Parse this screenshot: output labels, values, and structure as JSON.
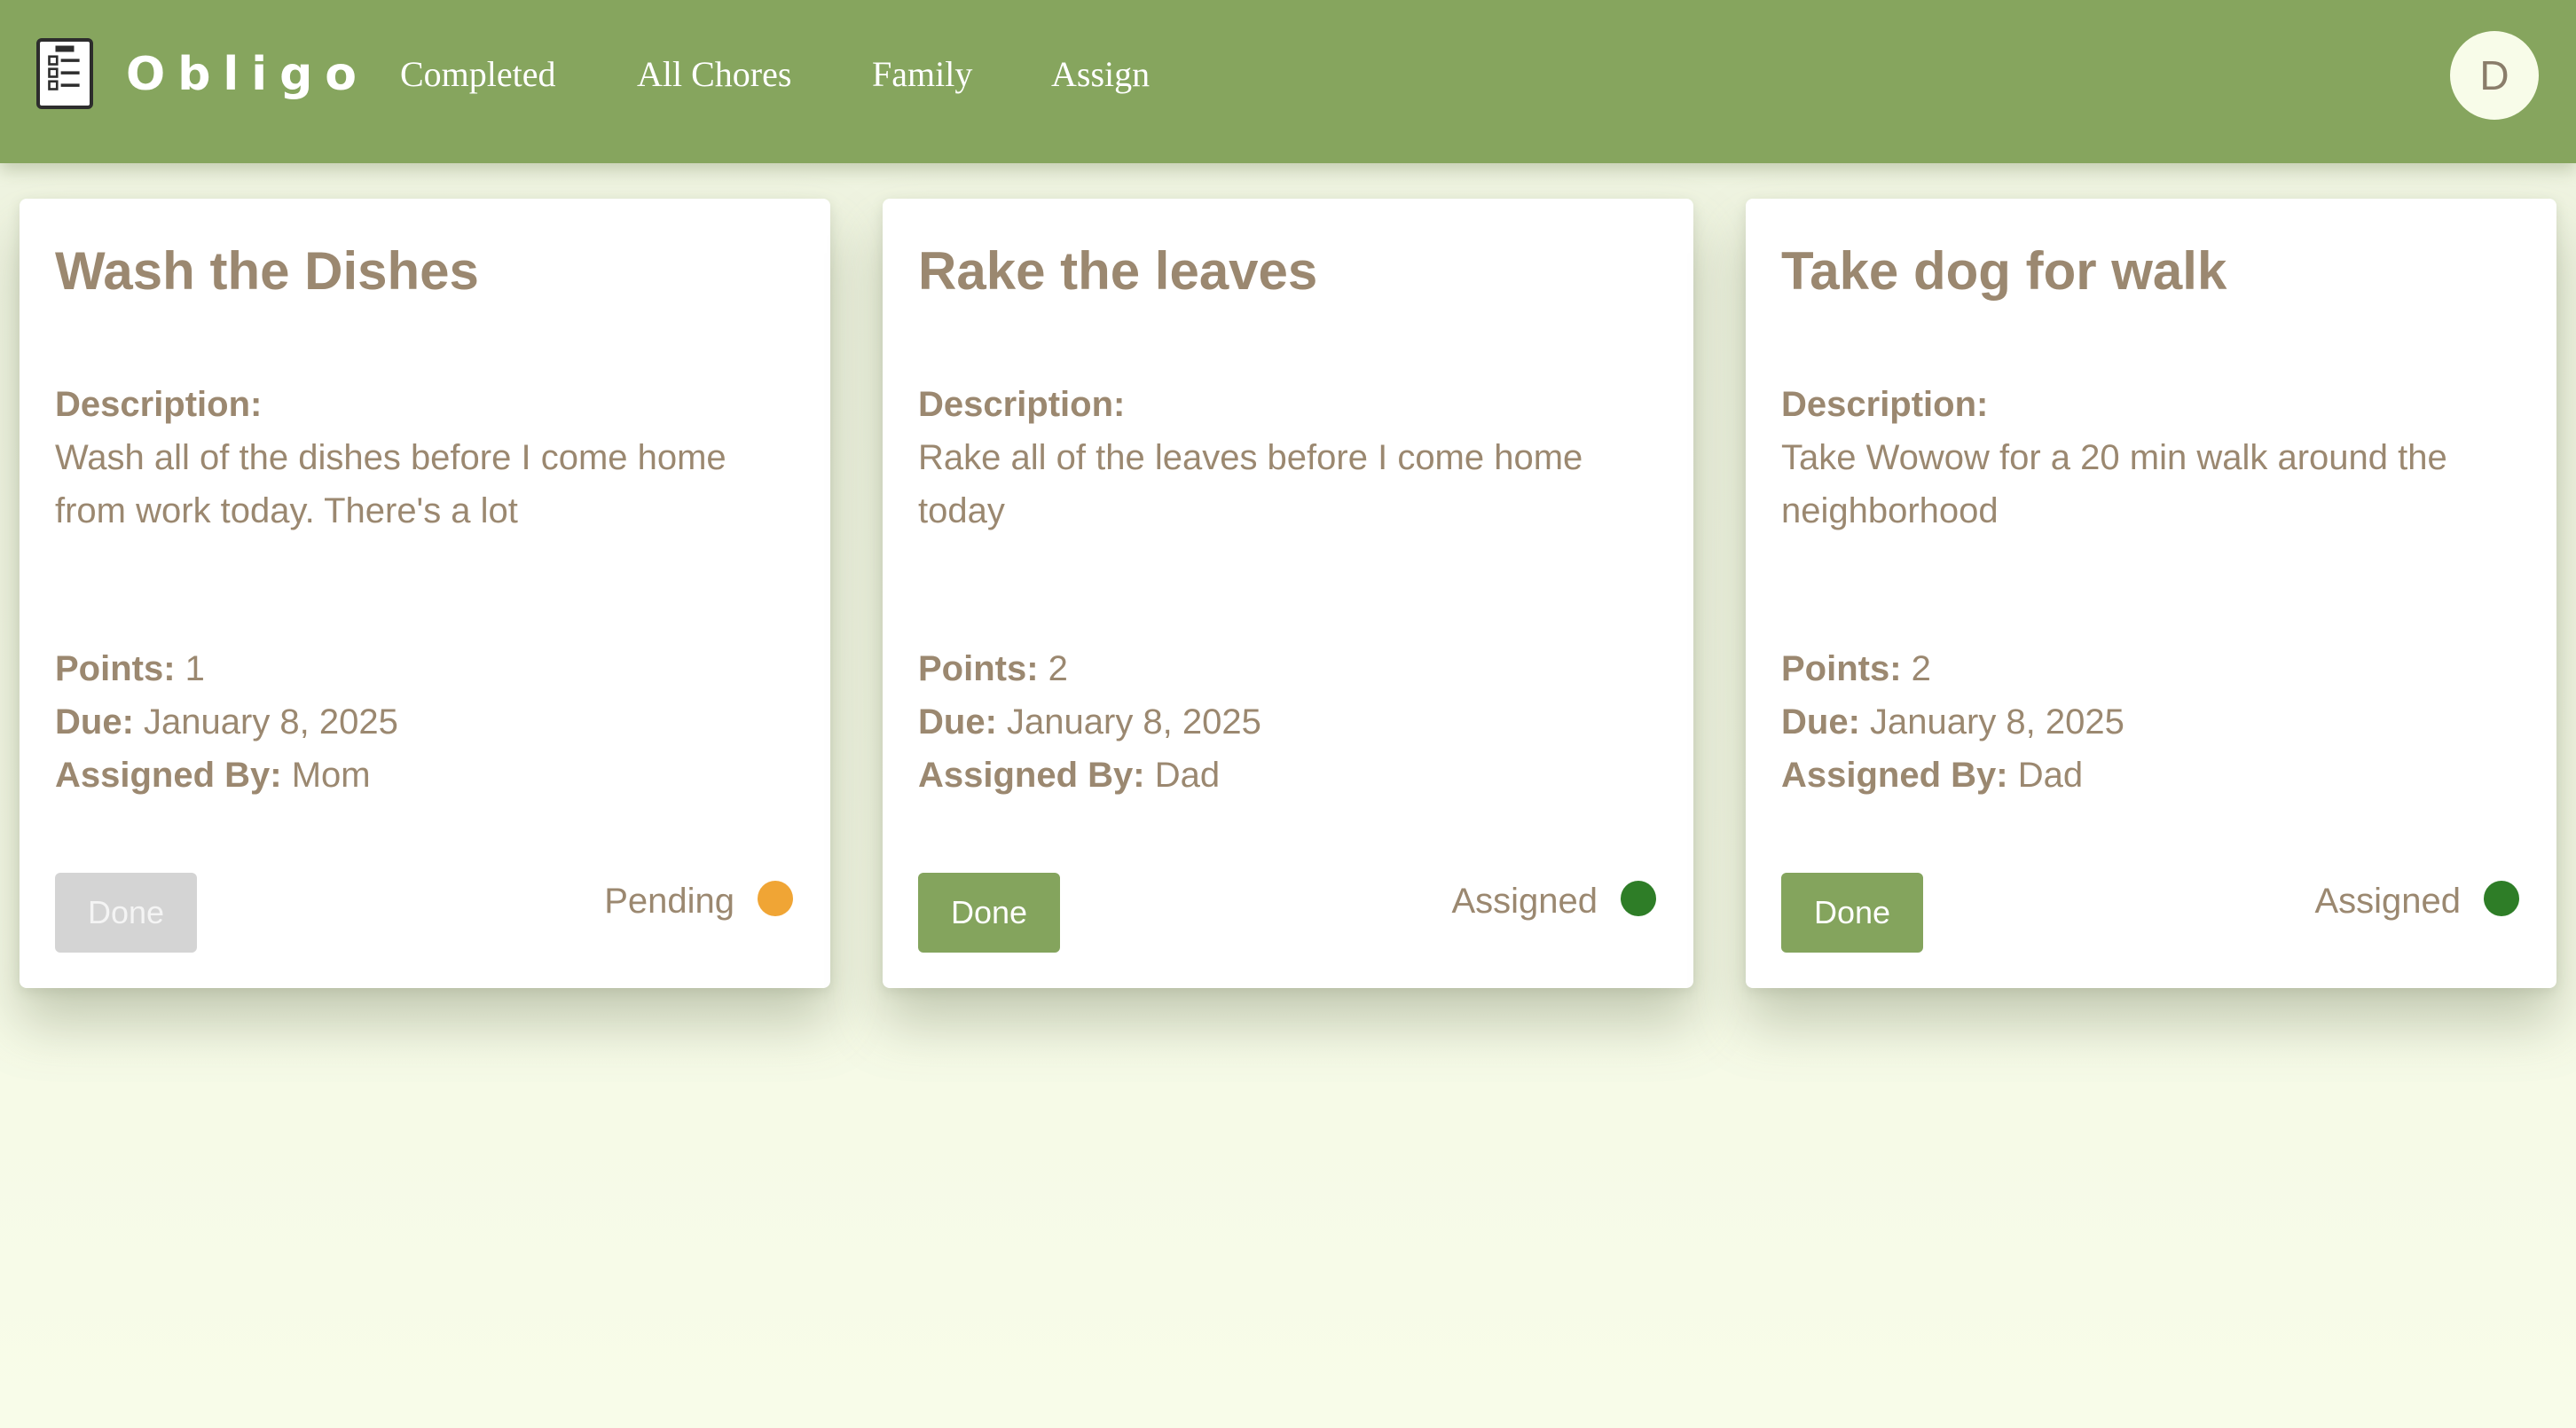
{
  "app": {
    "brand": "Obligo",
    "nav": [
      {
        "label": "Completed"
      },
      {
        "label": "All Chores"
      },
      {
        "label": "Family"
      },
      {
        "label": "Assign"
      }
    ],
    "avatar_initial": "D",
    "colors": {
      "header": "#86a55e",
      "background": "#f8fce9",
      "text": "#9b8870",
      "pending": "#f0a535",
      "assigned": "#2e7d27"
    }
  },
  "labels": {
    "description": "Description:",
    "points": "Points:",
    "due": "Due:",
    "assigned_by": "Assigned By:"
  },
  "chores": [
    {
      "title": "Wash the Dishes",
      "description": "Wash all of the dishes before I come home from work today. There's a lot",
      "points": "1",
      "due": "January 8, 2025",
      "assigned_by": "Mom",
      "button_label": "Done",
      "button_enabled": false,
      "status": "Pending",
      "status_color": "#f0a535"
    },
    {
      "title": "Rake the leaves",
      "description": "Rake all of the leaves before I come home today",
      "points": "2",
      "due": "January 8, 2025",
      "assigned_by": "Dad",
      "button_label": "Done",
      "button_enabled": true,
      "status": "Assigned",
      "status_color": "#2e7d27"
    },
    {
      "title": "Take dog for walk",
      "description": "Take Wowow for a 20 min walk around the neighborhood",
      "points": "2",
      "due": "January 8, 2025",
      "assigned_by": "Dad",
      "button_label": "Done",
      "button_enabled": true,
      "status": "Assigned",
      "status_color": "#2e7d27"
    }
  ]
}
